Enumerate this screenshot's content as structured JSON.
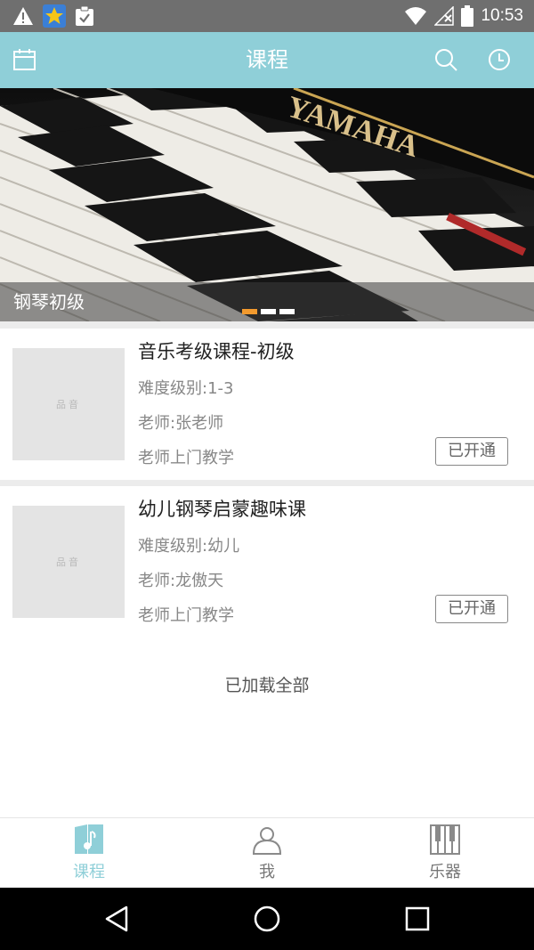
{
  "status_bar": {
    "time": "10:53",
    "icons": [
      "warning-icon",
      "star-app-icon",
      "clipboard-check-icon",
      "wifi-icon",
      "no-signal-icon",
      "battery-icon"
    ]
  },
  "header": {
    "title": "课程",
    "left_icon": "calendar-icon",
    "right_icons": [
      "search-icon",
      "history-clock-icon"
    ],
    "color": "#8fcfd8"
  },
  "banner": {
    "caption": "钢琴初级",
    "brand_text": "YAMAHA",
    "slide_count": 3,
    "active_slide": 1,
    "indicator_active_color": "#f29a2e"
  },
  "courses": [
    {
      "title": "音乐考级课程-初级",
      "level": "难度级别:1-3",
      "teacher": "老师:张老师",
      "mode": "老师上门教学",
      "status": "已开通",
      "thumb_placeholder": "品音"
    },
    {
      "title": "幼儿钢琴启蒙趣味课",
      "level": "难度级别:幼儿",
      "teacher": "老师:龙傲天",
      "mode": "老师上门教学",
      "status": "已开通",
      "thumb_placeholder": "品音"
    }
  ],
  "footer_text": "已加载全部",
  "tabs": [
    {
      "label": "课程",
      "icon": "music-book-icon",
      "active": true
    },
    {
      "label": "我",
      "icon": "person-icon",
      "active": false
    },
    {
      "label": "乐器",
      "icon": "piano-keys-icon",
      "active": false
    }
  ],
  "nav_bar": {
    "buttons": [
      "back-triangle-icon",
      "home-circle-icon",
      "recents-square-icon"
    ]
  }
}
